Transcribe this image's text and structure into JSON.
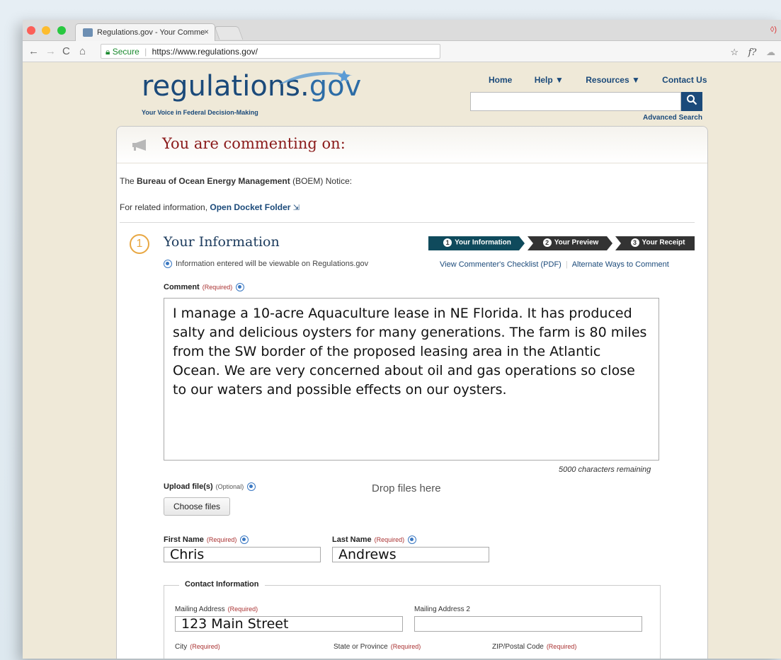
{
  "browser": {
    "tab_title": "Regulations.gov - Your Comme",
    "tab_close": "×",
    "secure_label": "Secure",
    "url": "https://www.regulations.gov/",
    "rec_indicator": "◊)"
  },
  "site": {
    "logo_text_main": "regulations.",
    "logo_text_gov": "gov",
    "tagline": "Your Voice in Federal Decision-Making",
    "nav": [
      "Home",
      "Help ▼",
      "Resources ▼",
      "Contact Us"
    ],
    "search_button": "🔍",
    "advanced_search": "Advanced Search"
  },
  "panel": {
    "heading": "You are commenting on:",
    "notice_prefix": "The ",
    "notice_agency": "Bureau of Ocean Energy Management",
    "notice_suffix": " (BOEM) Notice:",
    "related_prefix": "For related information, ",
    "related_link": "Open Docket Folder",
    "step_number": "1",
    "step_heading": "Your Information",
    "progress": [
      {
        "num": "1",
        "label": "Your Information"
      },
      {
        "num": "2",
        "label": "Your Preview"
      },
      {
        "num": "3",
        "label": "Your Receipt"
      }
    ],
    "info_note": "Information entered will be viewable on Regulations.gov",
    "checklist_link": "View Commenter's Checklist (PDF)",
    "alternate_link": "Alternate Ways to Comment"
  },
  "form": {
    "required_tag": "(Required)",
    "optional_tag": "(Optional)",
    "comment_label": "Comment",
    "comment_value": "I manage a 10-acre Aquaculture lease in NE Florida. It has produced salty and delicious oysters for many generations. The farm is 80 miles from the SW border of the proposed leasing area in the Atlantic Ocean. We are very concerned about oil and gas operations so close to our waters and possible effects on our oysters.",
    "chars_remaining": "5000 characters remaining",
    "upload_label": "Upload file(s)",
    "choose_files": "Choose files",
    "drop_files": "Drop files here",
    "first_name_label": "First Name",
    "first_name_value": "Chris",
    "last_name_label": "Last Name",
    "last_name_value": "Andrews",
    "contact_legend": "Contact Information",
    "mailing_address_label": "Mailing Address",
    "mailing_address_value": "123 Main Street",
    "mailing_address2_label": "Mailing Address 2",
    "mailing_address2_value": "",
    "city_label": "City",
    "state_label": "State or Province",
    "zip_label": "ZIP/Postal Code"
  },
  "colors": {
    "brand_navy": "#1b4a7a",
    "heading_red": "#8a1a1a",
    "step_orange": "#e8a742",
    "progress_active": "#0f4a5c",
    "progress_inactive": "#333333"
  }
}
